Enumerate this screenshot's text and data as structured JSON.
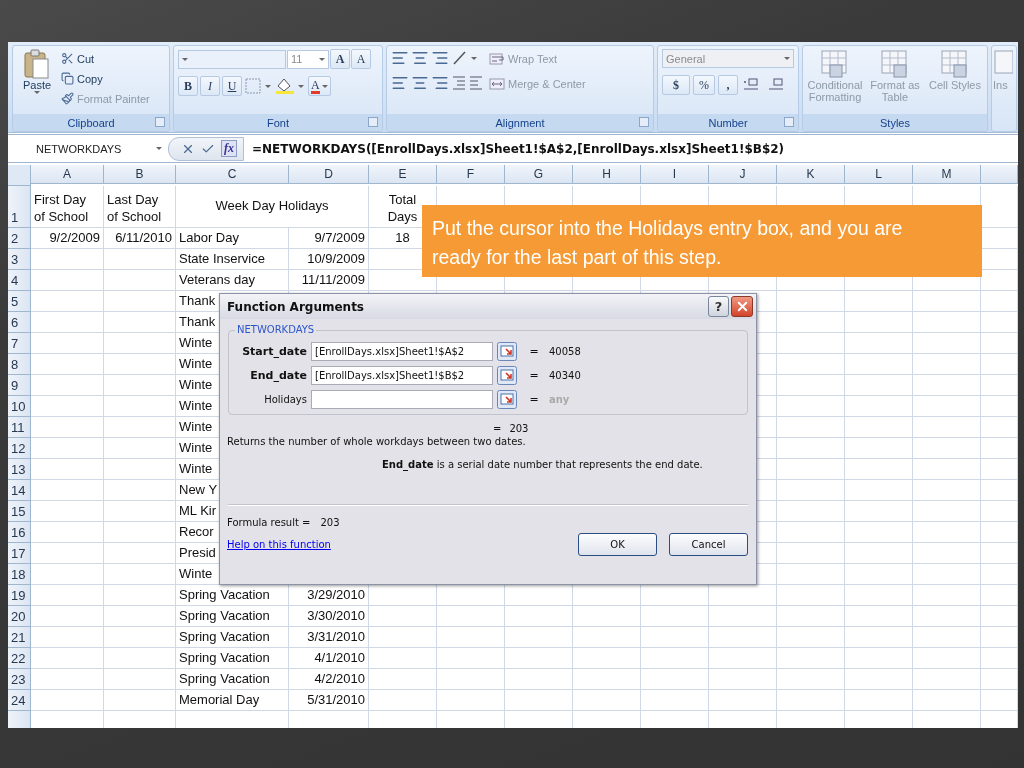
{
  "ribbon": {
    "clipboard": {
      "paste": "Paste",
      "items": [
        {
          "kind": "cut",
          "label": "Cut",
          "disabled": false
        },
        {
          "kind": "copy",
          "label": "Copy",
          "disabled": false
        },
        {
          "kind": "painter",
          "label": "Format Painter",
          "disabled": true
        }
      ],
      "label": "Clipboard"
    },
    "font": {
      "size": "11",
      "grow": "A",
      "shrink": "A",
      "bold": "B",
      "italic": "I",
      "underline": "U",
      "font_color": "A",
      "label": "Font"
    },
    "alignment": {
      "items": [
        {
          "kind": "wrap",
          "label": "Wrap Text",
          "disabled": true
        },
        {
          "kind": "merge",
          "label": "Merge & Center",
          "disabled": true
        }
      ],
      "label": "Alignment"
    },
    "number": {
      "format": "General",
      "currency": "$",
      "percent": "%",
      "comma": ",",
      "label": "Number"
    },
    "styles": {
      "buttons": [
        {
          "kind": "conditional",
          "label": "Conditional Formatting",
          "disabled": true
        },
        {
          "kind": "table",
          "label": "Format as Table",
          "disabled": true
        },
        {
          "kind": "cell",
          "label": "Cell Styles",
          "disabled": true
        }
      ],
      "label": "Styles"
    },
    "cells": {
      "insert": "Ins"
    }
  },
  "formula_bar": {
    "name_box": "NETWORKDAYS",
    "fx": "fx",
    "formula": "=NETWORKDAYS([EnrollDays.xlsx]Sheet1!$A$2,[EnrollDays.xlsx]Sheet1!$B$2)"
  },
  "sheet": {
    "columns": [
      "A",
      "B",
      "C",
      "D",
      "E",
      "F",
      "G",
      "H",
      "I",
      "J",
      "K",
      "L",
      "M"
    ],
    "rows": [
      {
        "number": "1",
        "kind": "header",
        "a": "First Day of School",
        "b": "Last Day of School",
        "c": "Week Day Holidays",
        "e": "Total Days"
      },
      {
        "number": "2",
        "kind": "data",
        "a": "9/2/2009",
        "b": "6/11/2010",
        "c": "Labor Day",
        "d": "9/7/2009",
        "e": "18"
      },
      {
        "number": "3",
        "kind": "data",
        "c": "State Inservice",
        "d": "10/9/2009"
      },
      {
        "number": "4",
        "kind": "data",
        "c": "Veterans day",
        "d": "11/11/2009"
      },
      {
        "number": "5",
        "kind": "data",
        "c": "Thank"
      },
      {
        "number": "6",
        "kind": "data",
        "c": "Thank"
      },
      {
        "number": "7",
        "kind": "data",
        "c": "Winte"
      },
      {
        "number": "8",
        "kind": "data",
        "c": "Winte"
      },
      {
        "number": "9",
        "kind": "data",
        "c": "Winte"
      },
      {
        "number": "10",
        "kind": "data",
        "c": "Winte"
      },
      {
        "number": "11",
        "kind": "data",
        "c": "Winte"
      },
      {
        "number": "12",
        "kind": "data",
        "c": "Winte"
      },
      {
        "number": "13",
        "kind": "data",
        "c": "Winte"
      },
      {
        "number": "14",
        "kind": "data",
        "c": "New Y"
      },
      {
        "number": "15",
        "kind": "data",
        "c": "ML Kir"
      },
      {
        "number": "16",
        "kind": "data",
        "c": "Recor"
      },
      {
        "number": "17",
        "kind": "data",
        "c": "Presid"
      },
      {
        "number": "18",
        "kind": "data",
        "c": "Winte"
      },
      {
        "number": "19",
        "kind": "data",
        "c": "Spring Vacation",
        "d": "3/29/2010"
      },
      {
        "number": "20",
        "kind": "data",
        "c": "Spring Vacation",
        "d": "3/30/2010"
      },
      {
        "number": "21",
        "kind": "data",
        "c": "Spring Vacation",
        "d": "3/31/2010"
      },
      {
        "number": "22",
        "kind": "data",
        "c": "Spring Vacation",
        "d": "4/1/2010"
      },
      {
        "number": "23",
        "kind": "data",
        "c": "Spring Vacation",
        "d": "4/2/2010"
      },
      {
        "number": "24",
        "kind": "data",
        "c": "Memorial Day",
        "d": "5/31/2010"
      }
    ]
  },
  "dialog": {
    "title": "Function Arguments",
    "help": "?",
    "function": "NETWORKDAYS",
    "args": [
      {
        "name": "Start_date",
        "value": "[EnrollDays.xlsx]Sheet1!$A$2",
        "equals": "=",
        "result": "40058",
        "required": true
      },
      {
        "name": "End_date",
        "value": "[EnrollDays.xlsx]Sheet1!$B$2",
        "equals": "=",
        "result": "40340",
        "required": true
      },
      {
        "name": "Holidays",
        "equals": "=",
        "result": "any",
        "required": false
      }
    ],
    "total": {
      "equals": "=",
      "value": "203"
    },
    "description": "Returns the number of whole workdays between two dates.",
    "arg_help": "**End_date**   is a serial date number that represents the end date.",
    "formula_result_label": "Formula result =",
    "formula_result": "203",
    "help_link": "Help on this function",
    "ok": "OK",
    "cancel": "Cancel"
  },
  "callout": "Put the cursor into the Holidays entry box, and you are ready for the last part of this step."
}
